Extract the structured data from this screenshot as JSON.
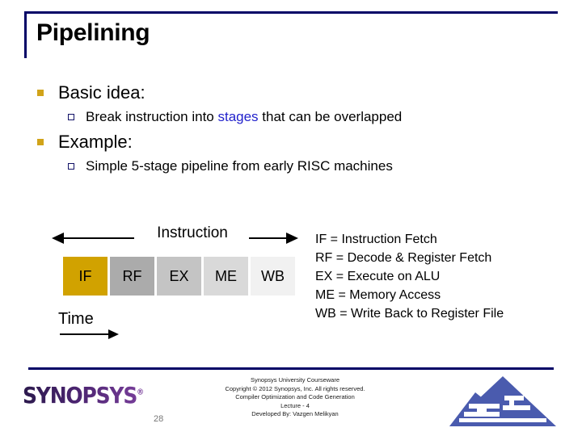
{
  "slide": {
    "title": "Pipelining",
    "page_number": "28"
  },
  "content": {
    "bullets": [
      {
        "level": 1,
        "text": "Basic idea:"
      },
      {
        "level": 2,
        "pre": "Break instruction into ",
        "highlight": "stages",
        "post": " that can be overlapped",
        "highlight_color": "#2222CC"
      },
      {
        "level": 1,
        "text": "Example:"
      },
      {
        "level": 2,
        "text": "Simple 5-stage pipeline from early RISC machines"
      }
    ]
  },
  "diagram": {
    "instruction_label": "Instruction",
    "time_label": "Time",
    "stages": [
      {
        "label": "IF",
        "color": "#D1A200"
      },
      {
        "label": "RF",
        "color": "#ABABAB"
      },
      {
        "label": "EX",
        "color": "#C4C4C4"
      },
      {
        "label": "ME",
        "color": "#D9D9D9"
      },
      {
        "label": "WB",
        "color": "#F1F1F1"
      }
    ]
  },
  "legend": {
    "lines": [
      "IF = Instruction Fetch",
      "RF = Decode & Register Fetch",
      "EX = Execute on ALU",
      "ME = Memory Access",
      "WB = Write Back to Register File"
    ]
  },
  "footer": {
    "logo_text": "SYNOPSYS",
    "logo_tm": "®",
    "lines": [
      "Synopsys University Courseware",
      "Copyright © 2012 Synopsys, Inc. All rights reserved.",
      "Compiler Optimization and Code Generation",
      "Lecture - 4",
      "Developed By: Vazgen Melikyan"
    ]
  },
  "theme": {
    "accent_navy": "#000066",
    "bullet_gold": "#D1A319",
    "link_blue": "#2222CC",
    "mountain_blue": "#4A5BAE"
  }
}
